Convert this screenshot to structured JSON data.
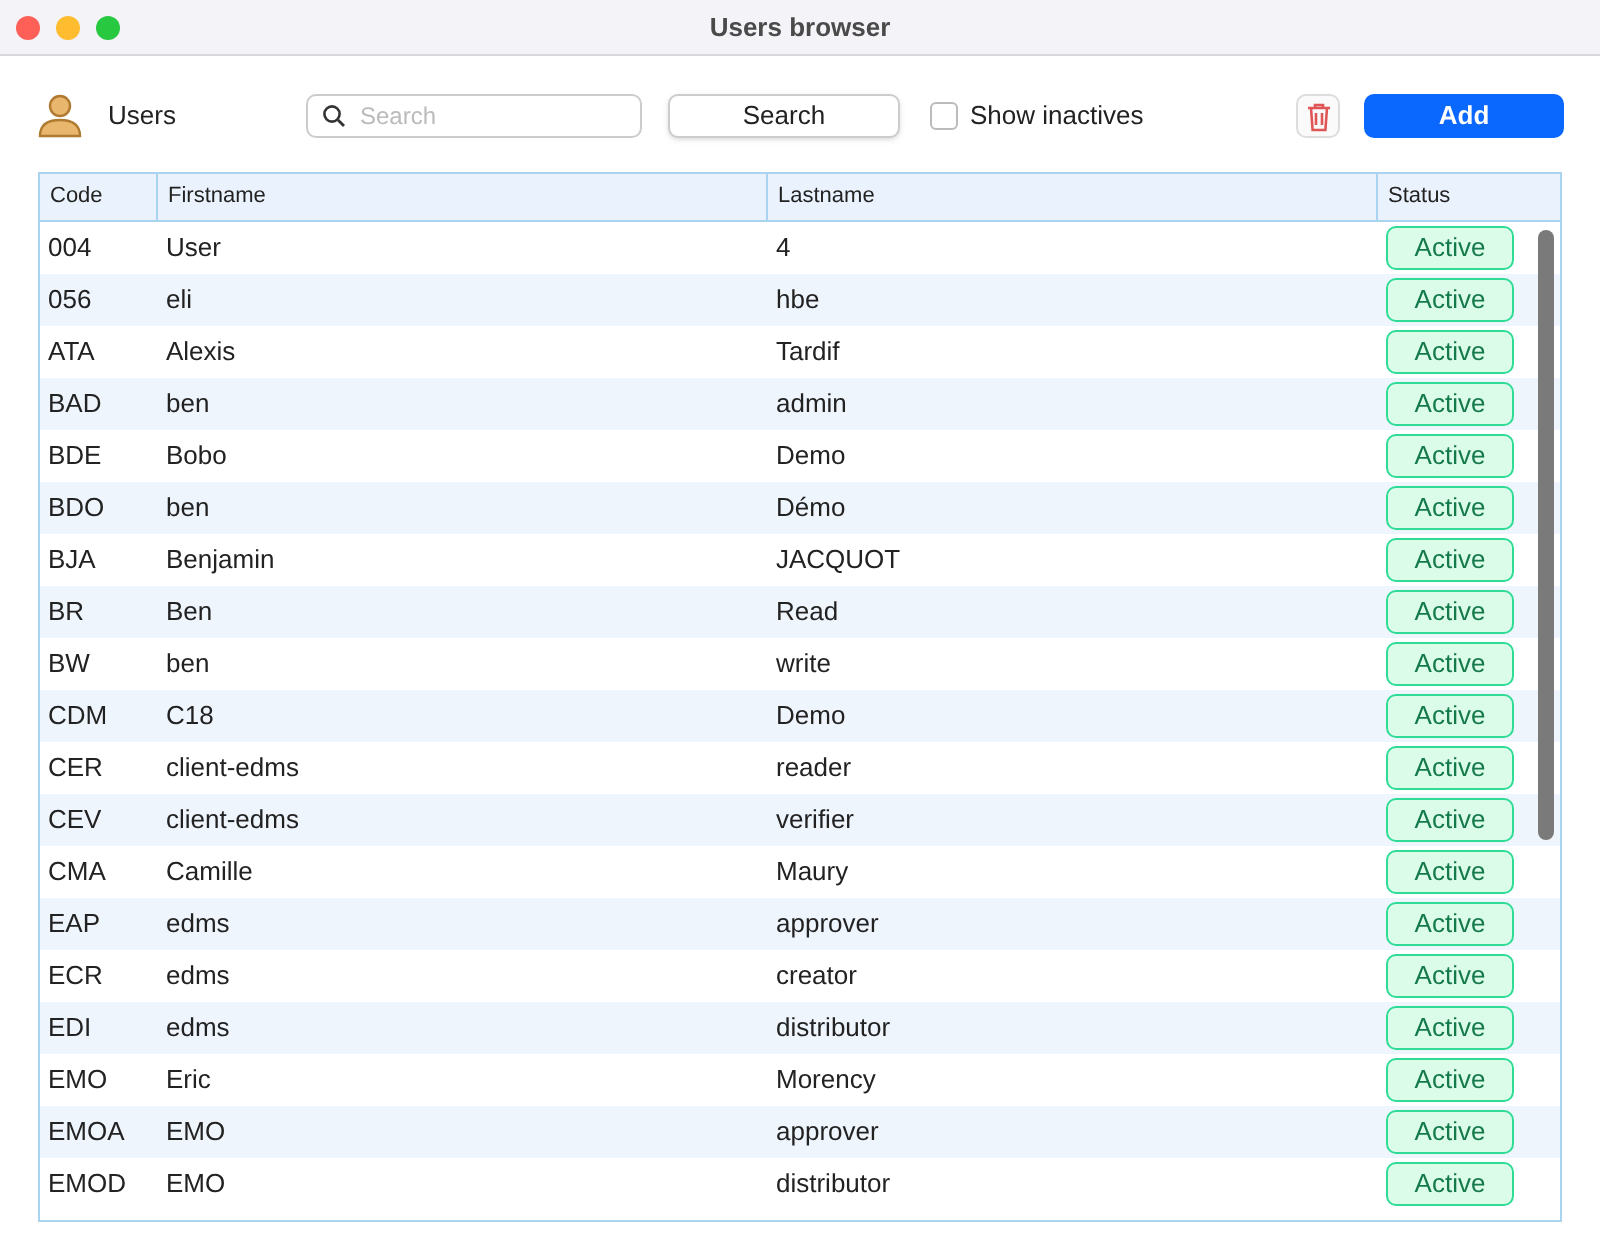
{
  "window": {
    "title": "Users browser"
  },
  "toolbar": {
    "label": "Users",
    "search": {
      "placeholder": "Search"
    },
    "search_button": "Search",
    "show_inactives": {
      "label": "Show inactives",
      "checked": false
    },
    "add_button": "Add"
  },
  "table": {
    "columns": [
      "Code",
      "Firstname",
      "Lastname",
      "Status"
    ],
    "rows": [
      {
        "code": "004",
        "firstname": "User",
        "lastname": "4",
        "status": "Active"
      },
      {
        "code": "056",
        "firstname": "eli",
        "lastname": "hbe",
        "status": "Active"
      },
      {
        "code": "ATA",
        "firstname": "Alexis",
        "lastname": "Tardif",
        "status": "Active"
      },
      {
        "code": "BAD",
        "firstname": "ben",
        "lastname": "admin",
        "status": "Active"
      },
      {
        "code": "BDE",
        "firstname": "Bobo",
        "lastname": "Demo",
        "status": "Active"
      },
      {
        "code": "BDO",
        "firstname": "ben",
        "lastname": "Démo",
        "status": "Active"
      },
      {
        "code": "BJA",
        "firstname": "Benjamin",
        "lastname": "JACQUOT",
        "status": "Active"
      },
      {
        "code": "BR",
        "firstname": "Ben",
        "lastname": "Read",
        "status": "Active"
      },
      {
        "code": "BW",
        "firstname": "ben",
        "lastname": "write",
        "status": "Active"
      },
      {
        "code": "CDM",
        "firstname": "C18",
        "lastname": "Demo",
        "status": "Active"
      },
      {
        "code": "CER",
        "firstname": "client-edms",
        "lastname": "reader",
        "status": "Active"
      },
      {
        "code": "CEV",
        "firstname": "client-edms",
        "lastname": "verifier",
        "status": "Active"
      },
      {
        "code": "CMA",
        "firstname": "Camille",
        "lastname": "Maury",
        "status": "Active"
      },
      {
        "code": "EAP",
        "firstname": "edms",
        "lastname": "approver",
        "status": "Active"
      },
      {
        "code": "ECR",
        "firstname": "edms",
        "lastname": "creator",
        "status": "Active"
      },
      {
        "code": "EDI",
        "firstname": "edms",
        "lastname": "distributor",
        "status": "Active"
      },
      {
        "code": "EMO",
        "firstname": "Eric",
        "lastname": "Morency",
        "status": "Active"
      },
      {
        "code": "EMOA",
        "firstname": "EMO",
        "lastname": "approver",
        "status": "Active"
      },
      {
        "code": "EMOD",
        "firstname": "EMO",
        "lastname": "distributor",
        "status": "Active"
      }
    ]
  }
}
